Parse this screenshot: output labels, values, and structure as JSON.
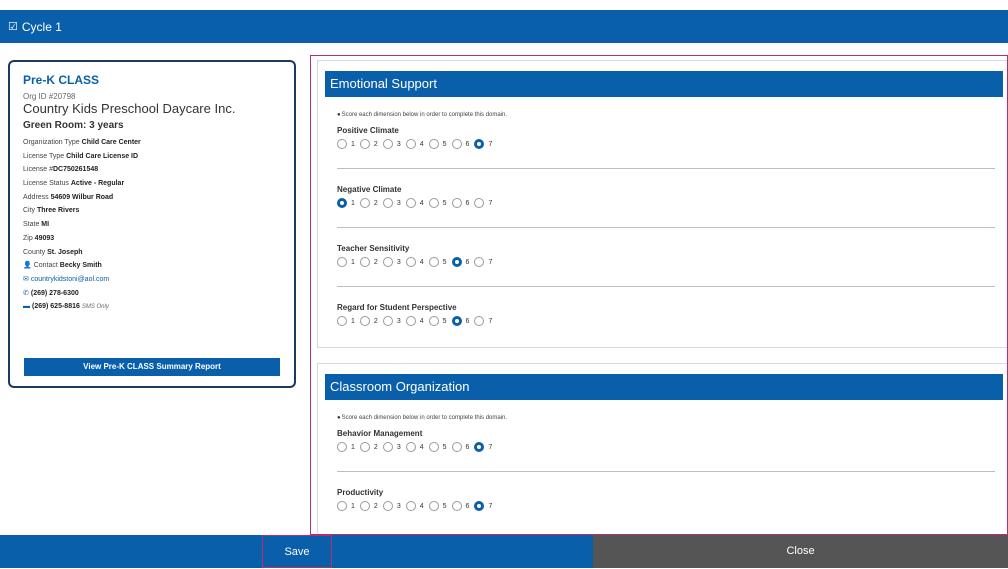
{
  "cycle": {
    "label": "Cycle 1"
  },
  "org": {
    "title": "Pre-K CLASS",
    "org_id": "Org ID #20798",
    "name": "Country Kids Preschool Daycare Inc.",
    "room": "Green Room: 3 years",
    "fields": [
      {
        "label": "Organization Type ",
        "value": "Child Care Center"
      },
      {
        "label": "License Type ",
        "value": "Child Care License ID"
      },
      {
        "label": "License #",
        "value": "DC750261548"
      },
      {
        "label": "License Status ",
        "value": "Active - Regular"
      },
      {
        "label": "Address ",
        "value": "54609 Wilbur Road"
      },
      {
        "label": "City ",
        "value": "Three Rivers"
      },
      {
        "label": "State ",
        "value": "MI"
      },
      {
        "label": "Zip ",
        "value": "49093"
      },
      {
        "label": "County ",
        "value": "St. Joseph"
      }
    ],
    "contact_label": "Contact ",
    "contact_name": "Becky Smith",
    "email": "countrykidstoni@aol.com",
    "phone": "(269) 278-6300",
    "sms_phone": "(269) 625-8816",
    "sms_note": "SMS Only",
    "summary_button": "View Pre-K CLASS Summary Report"
  },
  "domains": [
    {
      "title": "Emotional Support",
      "note": "Score each dimension below in order to complete this domain.",
      "dimensions": [
        {
          "name": "Positive Climate",
          "selected": 7
        },
        {
          "name": "Negative Climate",
          "selected": 1
        },
        {
          "name": "Teacher Sensitivity",
          "selected": 6
        },
        {
          "name": "Regard for Student Perspective",
          "selected": 6
        }
      ]
    },
    {
      "title": "Classroom Organization",
      "note": "Score each dimension below in order to complete this domain.",
      "dimensions": [
        {
          "name": "Behavior Management",
          "selected": 7
        },
        {
          "name": "Productivity",
          "selected": 7
        }
      ]
    }
  ],
  "score_options": [
    "1",
    "2",
    "3",
    "4",
    "5",
    "6",
    "7"
  ],
  "footer": {
    "save_label": "Save",
    "close_label": "Close"
  },
  "colors": {
    "primary": "#0a5fab",
    "highlight": "#b3306f",
    "close_bg": "#555555"
  }
}
